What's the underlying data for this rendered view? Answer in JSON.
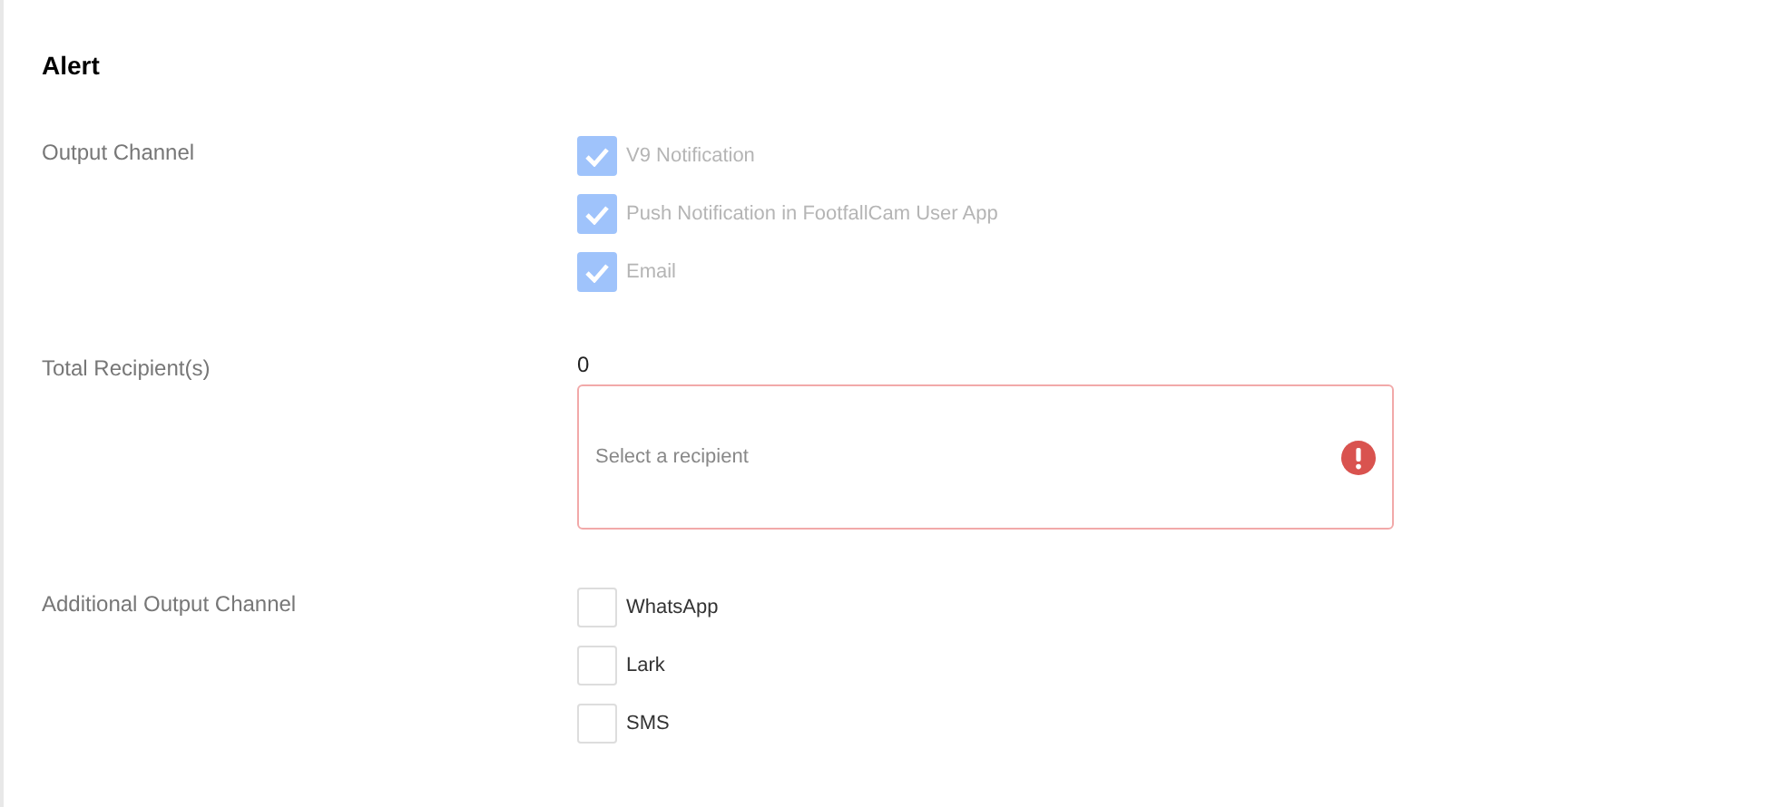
{
  "title": "Alert",
  "output_channel": {
    "label": "Output Channel",
    "options": [
      {
        "label": "V9 Notification",
        "checked": true,
        "disabled": true
      },
      {
        "label": "Push Notification in FootfallCam User App",
        "checked": true,
        "disabled": true
      },
      {
        "label": "Email",
        "checked": true,
        "disabled": true
      }
    ]
  },
  "recipients": {
    "label": "Total Recipient(s)",
    "count": "0",
    "placeholder": "Select a recipient",
    "error": true
  },
  "additional_output_channel": {
    "label": "Additional Output Channel",
    "options": [
      {
        "label": "WhatsApp",
        "checked": false,
        "disabled": false
      },
      {
        "label": "Lark",
        "checked": false,
        "disabled": false
      },
      {
        "label": "SMS",
        "checked": false,
        "disabled": false
      }
    ]
  }
}
